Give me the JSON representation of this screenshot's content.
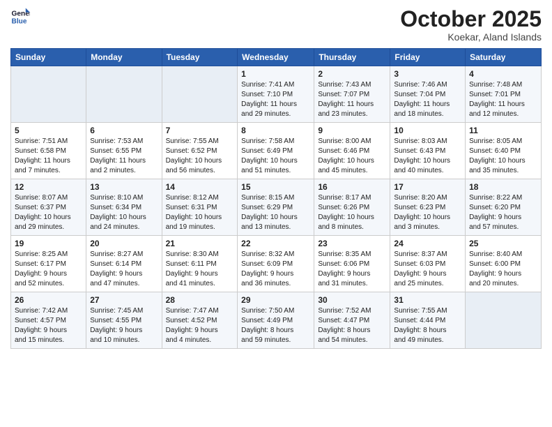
{
  "header": {
    "logo_line1": "General",
    "logo_line2": "Blue",
    "month": "October 2025",
    "location": "Koekar, Aland Islands"
  },
  "weekdays": [
    "Sunday",
    "Monday",
    "Tuesday",
    "Wednesday",
    "Thursday",
    "Friday",
    "Saturday"
  ],
  "weeks": [
    [
      {
        "day": "",
        "info": ""
      },
      {
        "day": "",
        "info": ""
      },
      {
        "day": "",
        "info": ""
      },
      {
        "day": "1",
        "info": "Sunrise: 7:41 AM\nSunset: 7:10 PM\nDaylight: 11 hours\nand 29 minutes."
      },
      {
        "day": "2",
        "info": "Sunrise: 7:43 AM\nSunset: 7:07 PM\nDaylight: 11 hours\nand 23 minutes."
      },
      {
        "day": "3",
        "info": "Sunrise: 7:46 AM\nSunset: 7:04 PM\nDaylight: 11 hours\nand 18 minutes."
      },
      {
        "day": "4",
        "info": "Sunrise: 7:48 AM\nSunset: 7:01 PM\nDaylight: 11 hours\nand 12 minutes."
      }
    ],
    [
      {
        "day": "5",
        "info": "Sunrise: 7:51 AM\nSunset: 6:58 PM\nDaylight: 11 hours\nand 7 minutes."
      },
      {
        "day": "6",
        "info": "Sunrise: 7:53 AM\nSunset: 6:55 PM\nDaylight: 11 hours\nand 2 minutes."
      },
      {
        "day": "7",
        "info": "Sunrise: 7:55 AM\nSunset: 6:52 PM\nDaylight: 10 hours\nand 56 minutes."
      },
      {
        "day": "8",
        "info": "Sunrise: 7:58 AM\nSunset: 6:49 PM\nDaylight: 10 hours\nand 51 minutes."
      },
      {
        "day": "9",
        "info": "Sunrise: 8:00 AM\nSunset: 6:46 PM\nDaylight: 10 hours\nand 45 minutes."
      },
      {
        "day": "10",
        "info": "Sunrise: 8:03 AM\nSunset: 6:43 PM\nDaylight: 10 hours\nand 40 minutes."
      },
      {
        "day": "11",
        "info": "Sunrise: 8:05 AM\nSunset: 6:40 PM\nDaylight: 10 hours\nand 35 minutes."
      }
    ],
    [
      {
        "day": "12",
        "info": "Sunrise: 8:07 AM\nSunset: 6:37 PM\nDaylight: 10 hours\nand 29 minutes."
      },
      {
        "day": "13",
        "info": "Sunrise: 8:10 AM\nSunset: 6:34 PM\nDaylight: 10 hours\nand 24 minutes."
      },
      {
        "day": "14",
        "info": "Sunrise: 8:12 AM\nSunset: 6:31 PM\nDaylight: 10 hours\nand 19 minutes."
      },
      {
        "day": "15",
        "info": "Sunrise: 8:15 AM\nSunset: 6:29 PM\nDaylight: 10 hours\nand 13 minutes."
      },
      {
        "day": "16",
        "info": "Sunrise: 8:17 AM\nSunset: 6:26 PM\nDaylight: 10 hours\nand 8 minutes."
      },
      {
        "day": "17",
        "info": "Sunrise: 8:20 AM\nSunset: 6:23 PM\nDaylight: 10 hours\nand 3 minutes."
      },
      {
        "day": "18",
        "info": "Sunrise: 8:22 AM\nSunset: 6:20 PM\nDaylight: 9 hours\nand 57 minutes."
      }
    ],
    [
      {
        "day": "19",
        "info": "Sunrise: 8:25 AM\nSunset: 6:17 PM\nDaylight: 9 hours\nand 52 minutes."
      },
      {
        "day": "20",
        "info": "Sunrise: 8:27 AM\nSunset: 6:14 PM\nDaylight: 9 hours\nand 47 minutes."
      },
      {
        "day": "21",
        "info": "Sunrise: 8:30 AM\nSunset: 6:11 PM\nDaylight: 9 hours\nand 41 minutes."
      },
      {
        "day": "22",
        "info": "Sunrise: 8:32 AM\nSunset: 6:09 PM\nDaylight: 9 hours\nand 36 minutes."
      },
      {
        "day": "23",
        "info": "Sunrise: 8:35 AM\nSunset: 6:06 PM\nDaylight: 9 hours\nand 31 minutes."
      },
      {
        "day": "24",
        "info": "Sunrise: 8:37 AM\nSunset: 6:03 PM\nDaylight: 9 hours\nand 25 minutes."
      },
      {
        "day": "25",
        "info": "Sunrise: 8:40 AM\nSunset: 6:00 PM\nDaylight: 9 hours\nand 20 minutes."
      }
    ],
    [
      {
        "day": "26",
        "info": "Sunrise: 7:42 AM\nSunset: 4:57 PM\nDaylight: 9 hours\nand 15 minutes."
      },
      {
        "day": "27",
        "info": "Sunrise: 7:45 AM\nSunset: 4:55 PM\nDaylight: 9 hours\nand 10 minutes."
      },
      {
        "day": "28",
        "info": "Sunrise: 7:47 AM\nSunset: 4:52 PM\nDaylight: 9 hours\nand 4 minutes."
      },
      {
        "day": "29",
        "info": "Sunrise: 7:50 AM\nSunset: 4:49 PM\nDaylight: 8 hours\nand 59 minutes."
      },
      {
        "day": "30",
        "info": "Sunrise: 7:52 AM\nSunset: 4:47 PM\nDaylight: 8 hours\nand 54 minutes."
      },
      {
        "day": "31",
        "info": "Sunrise: 7:55 AM\nSunset: 4:44 PM\nDaylight: 8 hours\nand 49 minutes."
      },
      {
        "day": "",
        "info": ""
      }
    ]
  ]
}
